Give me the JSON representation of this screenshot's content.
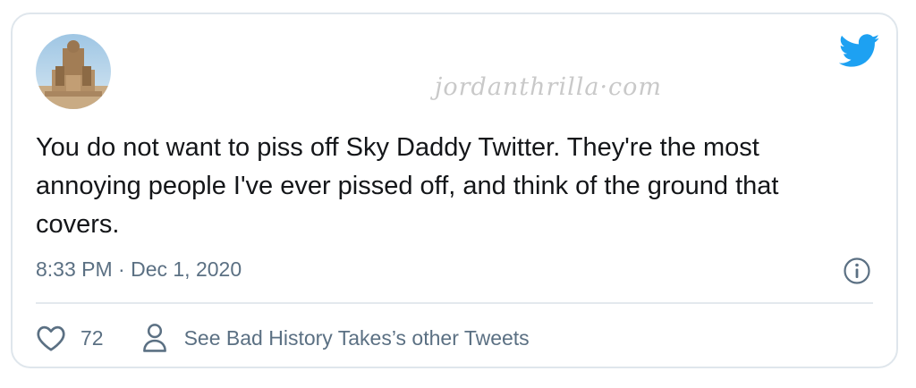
{
  "tweet": {
    "watermark": "jordanthrilla·com",
    "text": "You do not want to piss off Sky Daddy Twitter. They're the most annoying people I've ever pissed off, and think of the ground that covers.",
    "timestamp": "8:33 PM · Dec 1, 2020",
    "like_count": "72",
    "profile_link": "See Bad History Takes’s other Tweets"
  },
  "icons": {
    "brand": "twitter-bird-icon",
    "info": "info-icon",
    "like": "heart-icon",
    "profile": "person-icon"
  },
  "colors": {
    "twitter_blue": "#1da1f2",
    "text": "#141619",
    "muted": "#5b7083",
    "border": "#dfe6ec",
    "watermark": "#c9c9c9"
  }
}
